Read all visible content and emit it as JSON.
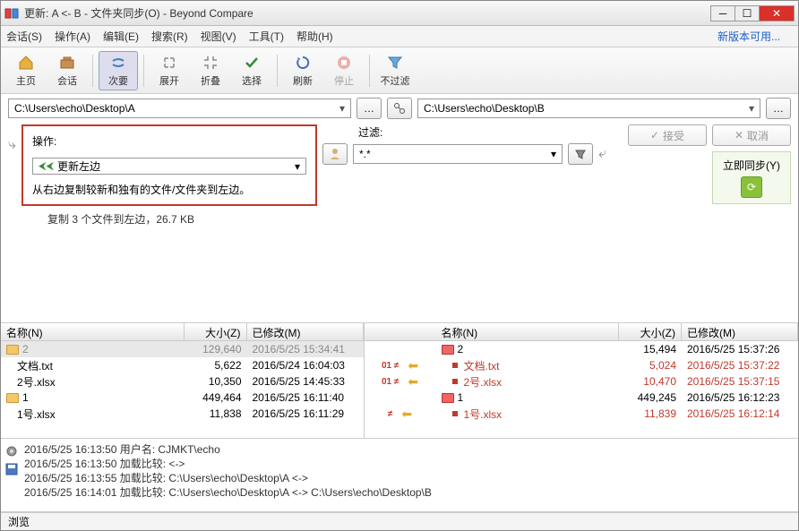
{
  "window": {
    "title": "更新: A <- B - 文件夹同步(O) - Beyond Compare"
  },
  "menu": {
    "session": "会话(S)",
    "operation": "操作(A)",
    "edit": "编辑(E)",
    "search": "搜索(R)",
    "view": "视图(V)",
    "tools": "工具(T)",
    "help": "帮助(H)",
    "update_link": "新版本可用..."
  },
  "toolbar": {
    "home": "主页",
    "session": "会话",
    "secondary": "次要",
    "expand": "展开",
    "collapse": "折叠",
    "select": "选择",
    "refresh": "刷新",
    "stop": "停止",
    "nofilter": "不过滤"
  },
  "paths": {
    "left": "C:\\Users\\echo\\Desktop\\A",
    "right": "C:\\Users\\echo\\Desktop\\B"
  },
  "operation": {
    "label": "操作:",
    "value": "更新左边",
    "desc": "从右边复制较新和独有的文件/文件夹到左边。"
  },
  "filter": {
    "label": "过滤:",
    "pattern": "*.*"
  },
  "actions": {
    "accept": "接受",
    "cancel": "取消",
    "sync": "立即同步(Y)"
  },
  "copyinfo": "复制 3 个文件到左边，26.7 KB",
  "columns": {
    "name": "名称(N)",
    "size": "大小(Z)",
    "modified": "已修改(M)"
  },
  "chart_data": {
    "type": "table",
    "left_pane": [
      {
        "name": "2",
        "type": "folder",
        "size": "129,640",
        "modified": "2016/5/25 15:34:41",
        "selected": true
      },
      {
        "name": "文档.txt",
        "type": "file",
        "size": "5,622",
        "modified": "2016/5/24 16:04:03",
        "indent": 1
      },
      {
        "name": "2号.xlsx",
        "type": "file",
        "size": "10,350",
        "modified": "2016/5/25 14:45:33",
        "indent": 1
      },
      {
        "name": "1",
        "type": "folder",
        "size": "449,464",
        "modified": "2016/5/25 16:11:40"
      },
      {
        "name": "1号.xlsx",
        "type": "file",
        "size": "11,838",
        "modified": "2016/5/25 16:11:29",
        "indent": 1
      }
    ],
    "right_pane": [
      {
        "name": "2",
        "type": "folder",
        "size": "15,494",
        "modified": "2016/5/25 15:37:26",
        "color": "red-folder"
      },
      {
        "name": "文档.txt",
        "type": "file",
        "size": "5,024",
        "modified": "2016/5/25 15:37:22",
        "indent": 1,
        "diff": true
      },
      {
        "name": "2号.xlsx",
        "type": "file",
        "size": "10,470",
        "modified": "2016/5/25 15:37:15",
        "indent": 1,
        "diff": true
      },
      {
        "name": "1",
        "type": "folder",
        "size": "449,245",
        "modified": "2016/5/25 16:12:23",
        "color": "red-folder"
      },
      {
        "name": "1号.xlsx",
        "type": "file",
        "size": "11,839",
        "modified": "2016/5/25 16:12:14",
        "indent": 1,
        "diff": true
      }
    ],
    "center": [
      {
        "neq": false,
        "arrow": false
      },
      {
        "neq": true,
        "arrow": true,
        "binary": true
      },
      {
        "neq": true,
        "arrow": true,
        "binary": true
      },
      {
        "neq": false,
        "arrow": false
      },
      {
        "neq": true,
        "arrow": true
      }
    ]
  },
  "log": [
    "2016/5/25 16:13:50  用户名: CJMKT\\echo",
    "2016/5/25 16:13:50  加载比较:  <->",
    "2016/5/25 16:13:55  加载比较: C:\\Users\\echo\\Desktop\\A <->",
    "2016/5/25 16:14:01  加载比较: C:\\Users\\echo\\Desktop\\A <-> C:\\Users\\echo\\Desktop\\B"
  ],
  "status": "浏览"
}
